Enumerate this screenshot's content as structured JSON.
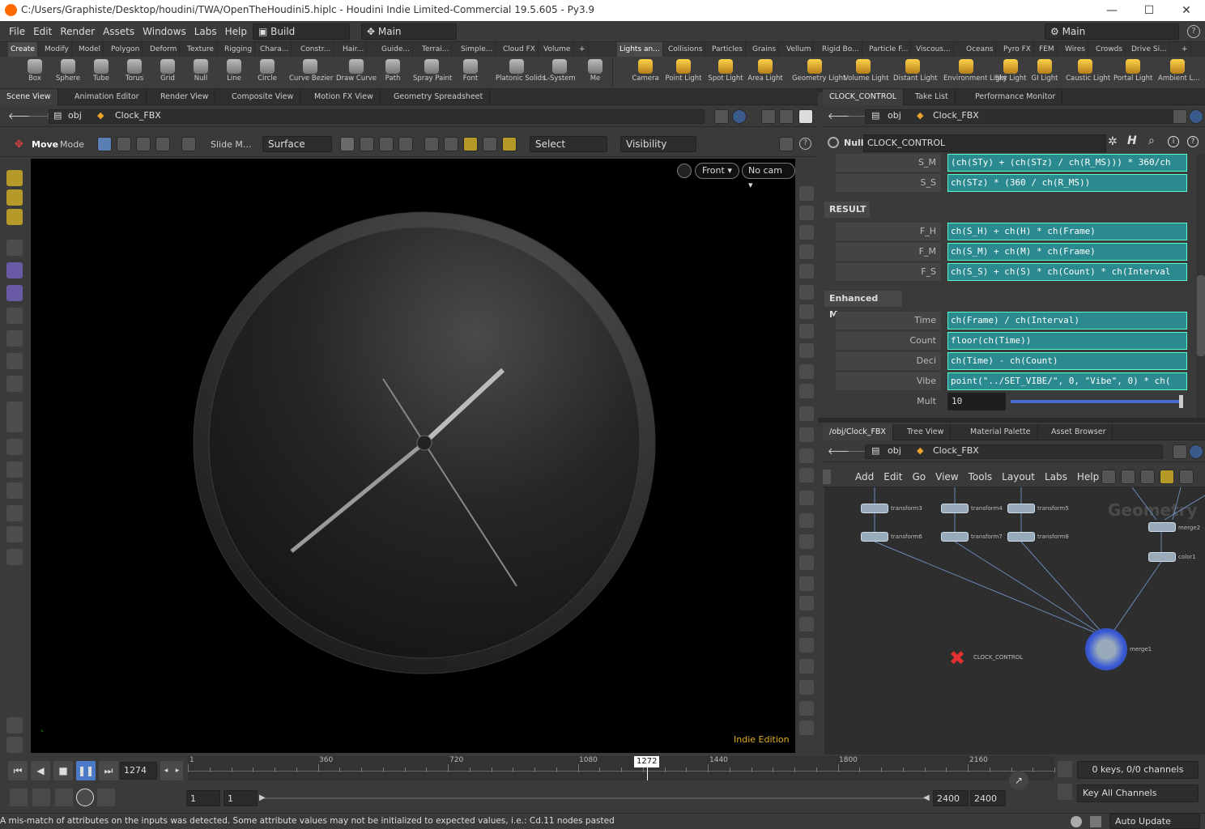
{
  "window": {
    "title": "C:/Users/Graphiste/Desktop/houdini/TWA/OpenTheHoudini5.hiplc - Houdini Indie Limited-Commercial 19.5.605 - Py3.9",
    "min": "—",
    "max": "☐",
    "close": "✕"
  },
  "menu": {
    "items": [
      "File",
      "Edit",
      "Render",
      "Assets",
      "Windows",
      "Labs",
      "Help"
    ],
    "desktop": "Build",
    "workspace": "Main",
    "right_workspace": "Main"
  },
  "shelf_tabs_left": [
    "Create",
    "Modify",
    "Model",
    "Polygon",
    "Deform",
    "Texture",
    "Rigging",
    "Chara...",
    "Constr...",
    "Hair...",
    "Guide...",
    "Terrai...",
    "Simple...",
    "Cloud FX",
    "Volume"
  ],
  "shelf_tabs_right": [
    "Lights an...",
    "Collisions",
    "Particles",
    "Grains",
    "Vellum",
    "Rigid Bo...",
    "Particle F...",
    "Viscous...",
    "Oceans",
    "Pyro FX",
    "FEM",
    "Wires",
    "Crowds",
    "Drive Si..."
  ],
  "tools_left": [
    "Box",
    "Sphere",
    "Tube",
    "Torus",
    "Grid",
    "Null",
    "Line",
    "Circle",
    "Curve Bezier",
    "Draw Curve",
    "Path",
    "Spray Paint",
    "Font",
    "Platonic Solids",
    "L-System",
    "Me"
  ],
  "tools_right": [
    "Camera",
    "Point Light",
    "Spot Light",
    "Area Light",
    "Geometry Light",
    "Volume Light",
    "Distant Light",
    "Environment Light",
    "Sky Light",
    "GI Light",
    "Caustic Light",
    "Portal Light",
    "Ambient L..."
  ],
  "left_pane_tabs": [
    "Scene View",
    "Animation Editor",
    "Render View",
    "Composite View",
    "Motion FX View",
    "Geometry Spreadsheet"
  ],
  "path": {
    "root": "obj",
    "current": "Clock_FBX"
  },
  "view_toolbar": {
    "mode_label": "Move",
    "mode_sub": "Mode",
    "slide": "Slide M...",
    "surface": "Surface",
    "select": "Select",
    "visibility": "Visibility"
  },
  "viewport": {
    "camera": "Front ▾",
    "cam": "No cam ▾",
    "watermark": "Indie Edition"
  },
  "right_pane_tabs": [
    "CLOCK_CONTROL",
    "Take List",
    "Performance Monitor"
  ],
  "param_header": {
    "type": "Null",
    "name": "CLOCK_CONTROL"
  },
  "params_top": [
    {
      "label": "S_M",
      "value": "(ch(STy) + (ch(STz) / ch(R_MS))) * 360/ch"
    },
    {
      "label": "S_S",
      "value": "ch(STz) * (360 / ch(R_MS))"
    }
  ],
  "folder_result": "RESULT",
  "params_result": [
    {
      "label": "F_H",
      "value": "ch(S_H) + ch(H) * ch(Frame)"
    },
    {
      "label": "F_M",
      "value": "ch(S_M) + ch(M) * ch(Frame)"
    },
    {
      "label": "F_S",
      "value": "ch(S_S) + ch(S) * ch(Count) * ch(Interval"
    }
  ],
  "folder_enhanced": "Enhanced Move",
  "params_enhanced": [
    {
      "label": "Time",
      "value": "ch(Frame) / ch(Interval)"
    },
    {
      "label": "Count",
      "value": "floor(ch(Time))"
    },
    {
      "label": "Deci",
      "value": "ch(Time) - ch(Count)"
    },
    {
      "label": "Vibe",
      "value": "point(\"../SET_VIBE/\", 0, \"Vibe\", 0) * ch("
    }
  ],
  "mult": {
    "label": "Mult",
    "value": "10",
    "slider_fraction": 0.98
  },
  "net_tabs": [
    "/obj/Clock_FBX",
    "Tree View",
    "Material Palette",
    "Asset Browser"
  ],
  "net_menu": [
    "Add",
    "Edit",
    "Go",
    "View",
    "Tools",
    "Layout",
    "Labs",
    "Help"
  ],
  "net_watermark": "Geometry",
  "nodes": [
    "transform3",
    "transform4",
    "transform5",
    "transform6",
    "transform7",
    "transform8",
    "merge2",
    "color1",
    "merge1",
    "CLOCK_CONTROL"
  ],
  "timeline": {
    "frame": "1274",
    "marker": "1272",
    "ticks": [
      "1",
      "360",
      "720",
      "1080",
      "1440",
      "1800",
      "2160"
    ],
    "start1": "1",
    "start2": "1",
    "end1": "2400",
    "end2": "2400",
    "progress_fraction": 0.53
  },
  "keys": {
    "channels": "0 keys, 0/0 channels",
    "key_all": "Key All Channels"
  },
  "status": {
    "message": "A mis-match of attributes on the inputs was detected.  Some attribute values may not be initialized to expected values, i.e.: Cd.11 nodes pasted",
    "auto_update": "Auto Update"
  }
}
